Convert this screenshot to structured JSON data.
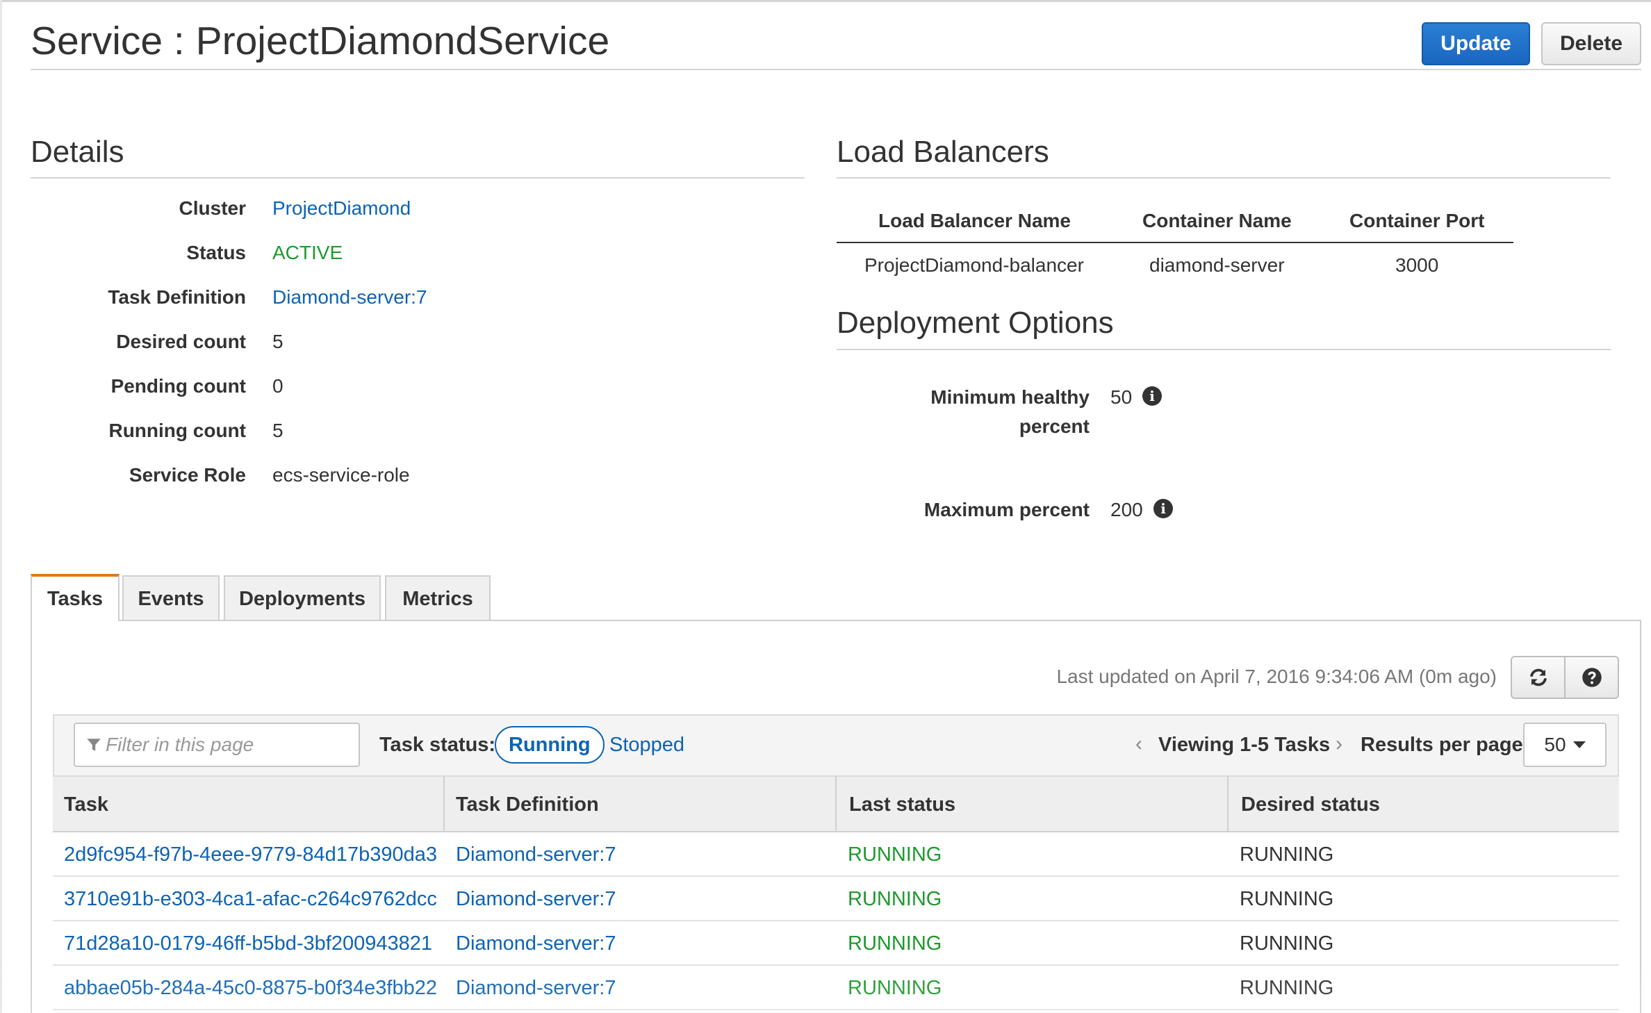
{
  "header": {
    "title": "Service : ProjectDiamondService",
    "update_label": "Update",
    "delete_label": "Delete"
  },
  "details": {
    "heading": "Details",
    "rows": [
      {
        "label": "Cluster",
        "value": "ProjectDiamond",
        "kind": "link"
      },
      {
        "label": "Status",
        "value": "ACTIVE",
        "kind": "status"
      },
      {
        "label": "Task Definition",
        "value": "Diamond-server:7",
        "kind": "link"
      },
      {
        "label": "Desired count",
        "value": "5",
        "kind": "text"
      },
      {
        "label": "Pending count",
        "value": "0",
        "kind": "text"
      },
      {
        "label": "Running count",
        "value": "5",
        "kind": "text"
      },
      {
        "label": "Service Role",
        "value": "ecs-service-role",
        "kind": "text"
      }
    ]
  },
  "load_balancers": {
    "heading": "Load Balancers",
    "columns": [
      "Load Balancer Name",
      "Container Name",
      "Container Port"
    ],
    "rows": [
      [
        "ProjectDiamond-balancer",
        "diamond-server",
        "3000"
      ]
    ]
  },
  "deployment_options": {
    "heading": "Deployment Options",
    "min_label_line1": "Minimum healthy",
    "min_label_line2": "percent",
    "min_value": "50",
    "max_label": "Maximum percent",
    "max_value": "200",
    "info_icon": "info-icon"
  },
  "tabs": [
    {
      "label": "Tasks",
      "active": true
    },
    {
      "label": "Events",
      "active": false
    },
    {
      "label": "Deployments",
      "active": false
    },
    {
      "label": "Metrics",
      "active": false
    }
  ],
  "tasks_panel": {
    "last_updated": "Last updated on April 7, 2016 9:34:06 AM (0m ago)",
    "refresh_icon": "refresh-icon",
    "help_icon": "help-icon",
    "filter_placeholder": "Filter in this page",
    "task_status_label": "Task status:",
    "status_running": "Running",
    "status_stopped": "Stopped",
    "viewing": "Viewing 1-5 Tasks",
    "results_per_page_label": "Results per page",
    "results_per_page": "50",
    "columns": [
      "Task",
      "Task Definition",
      "Last status",
      "Desired status"
    ],
    "rows": [
      {
        "task": "2d9fc954-f97b-4eee-9779-84d17b390da3",
        "definition": "Diamond-server:7",
        "last": "RUNNING",
        "desired": "RUNNING"
      },
      {
        "task": "3710e91b-e303-4ca1-afac-c264c9762dcc",
        "definition": "Diamond-server:7",
        "last": "RUNNING",
        "desired": "RUNNING"
      },
      {
        "task": "71d28a10-0179-46ff-b5bd-3bf200943821",
        "definition": "Diamond-server:7",
        "last": "RUNNING",
        "desired": "RUNNING"
      },
      {
        "task": "abbae05b-284a-45c0-8875-b0f34e3fbb22",
        "definition": "Diamond-server:7",
        "last": "RUNNING",
        "desired": "RUNNING"
      }
    ]
  },
  "colors": {
    "link": "#0d63b5",
    "status_ok": "#1d9a2c",
    "primary_button": "#1a66c0",
    "active_tab_accent": "#e07b1a"
  }
}
